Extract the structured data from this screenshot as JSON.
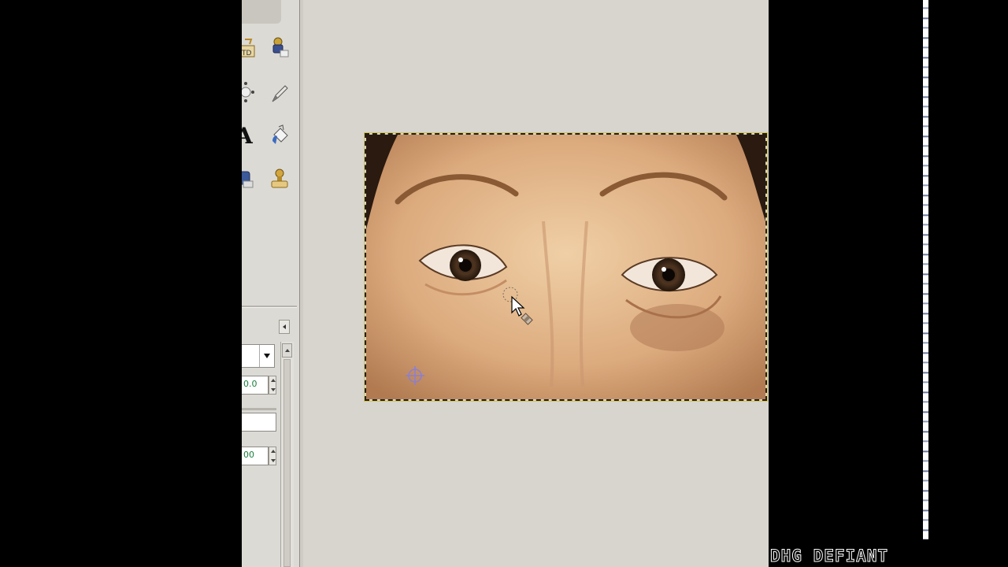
{
  "toolbox": {
    "tools": [
      {
        "name": "text-tool-icon"
      },
      {
        "name": "clone-stamp-icon"
      },
      {
        "name": "move-tool-icon"
      },
      {
        "name": "smudge-tool-icon"
      },
      {
        "name": "text-a-icon"
      },
      {
        "name": "bucket-fill-icon"
      },
      {
        "name": "paint-icon"
      },
      {
        "name": "heal-stamp-icon"
      }
    ],
    "options": {
      "field1_value": "0.0",
      "field3_value": "00"
    }
  },
  "canvas": {
    "background_color": "#d8d5ce"
  },
  "watermark": {
    "text": "DHG DEFIANT"
  }
}
